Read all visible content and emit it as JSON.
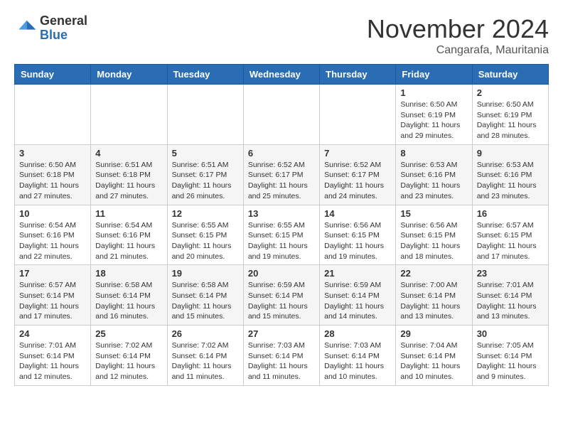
{
  "logo": {
    "general": "General",
    "blue": "Blue"
  },
  "title": "November 2024",
  "location": "Cangarafa, Mauritania",
  "weekdays": [
    "Sunday",
    "Monday",
    "Tuesday",
    "Wednesday",
    "Thursday",
    "Friday",
    "Saturday"
  ],
  "weeks": [
    [
      {
        "day": "",
        "info": ""
      },
      {
        "day": "",
        "info": ""
      },
      {
        "day": "",
        "info": ""
      },
      {
        "day": "",
        "info": ""
      },
      {
        "day": "",
        "info": ""
      },
      {
        "day": "1",
        "info": "Sunrise: 6:50 AM\nSunset: 6:19 PM\nDaylight: 11 hours and 29 minutes."
      },
      {
        "day": "2",
        "info": "Sunrise: 6:50 AM\nSunset: 6:19 PM\nDaylight: 11 hours and 28 minutes."
      }
    ],
    [
      {
        "day": "3",
        "info": "Sunrise: 6:50 AM\nSunset: 6:18 PM\nDaylight: 11 hours and 27 minutes."
      },
      {
        "day": "4",
        "info": "Sunrise: 6:51 AM\nSunset: 6:18 PM\nDaylight: 11 hours and 27 minutes."
      },
      {
        "day": "5",
        "info": "Sunrise: 6:51 AM\nSunset: 6:17 PM\nDaylight: 11 hours and 26 minutes."
      },
      {
        "day": "6",
        "info": "Sunrise: 6:52 AM\nSunset: 6:17 PM\nDaylight: 11 hours and 25 minutes."
      },
      {
        "day": "7",
        "info": "Sunrise: 6:52 AM\nSunset: 6:17 PM\nDaylight: 11 hours and 24 minutes."
      },
      {
        "day": "8",
        "info": "Sunrise: 6:53 AM\nSunset: 6:16 PM\nDaylight: 11 hours and 23 minutes."
      },
      {
        "day": "9",
        "info": "Sunrise: 6:53 AM\nSunset: 6:16 PM\nDaylight: 11 hours and 23 minutes."
      }
    ],
    [
      {
        "day": "10",
        "info": "Sunrise: 6:54 AM\nSunset: 6:16 PM\nDaylight: 11 hours and 22 minutes."
      },
      {
        "day": "11",
        "info": "Sunrise: 6:54 AM\nSunset: 6:16 PM\nDaylight: 11 hours and 21 minutes."
      },
      {
        "day": "12",
        "info": "Sunrise: 6:55 AM\nSunset: 6:15 PM\nDaylight: 11 hours and 20 minutes."
      },
      {
        "day": "13",
        "info": "Sunrise: 6:55 AM\nSunset: 6:15 PM\nDaylight: 11 hours and 19 minutes."
      },
      {
        "day": "14",
        "info": "Sunrise: 6:56 AM\nSunset: 6:15 PM\nDaylight: 11 hours and 19 minutes."
      },
      {
        "day": "15",
        "info": "Sunrise: 6:56 AM\nSunset: 6:15 PM\nDaylight: 11 hours and 18 minutes."
      },
      {
        "day": "16",
        "info": "Sunrise: 6:57 AM\nSunset: 6:15 PM\nDaylight: 11 hours and 17 minutes."
      }
    ],
    [
      {
        "day": "17",
        "info": "Sunrise: 6:57 AM\nSunset: 6:14 PM\nDaylight: 11 hours and 17 minutes."
      },
      {
        "day": "18",
        "info": "Sunrise: 6:58 AM\nSunset: 6:14 PM\nDaylight: 11 hours and 16 minutes."
      },
      {
        "day": "19",
        "info": "Sunrise: 6:58 AM\nSunset: 6:14 PM\nDaylight: 11 hours and 15 minutes."
      },
      {
        "day": "20",
        "info": "Sunrise: 6:59 AM\nSunset: 6:14 PM\nDaylight: 11 hours and 15 minutes."
      },
      {
        "day": "21",
        "info": "Sunrise: 6:59 AM\nSunset: 6:14 PM\nDaylight: 11 hours and 14 minutes."
      },
      {
        "day": "22",
        "info": "Sunrise: 7:00 AM\nSunset: 6:14 PM\nDaylight: 11 hours and 13 minutes."
      },
      {
        "day": "23",
        "info": "Sunrise: 7:01 AM\nSunset: 6:14 PM\nDaylight: 11 hours and 13 minutes."
      }
    ],
    [
      {
        "day": "24",
        "info": "Sunrise: 7:01 AM\nSunset: 6:14 PM\nDaylight: 11 hours and 12 minutes."
      },
      {
        "day": "25",
        "info": "Sunrise: 7:02 AM\nSunset: 6:14 PM\nDaylight: 11 hours and 12 minutes."
      },
      {
        "day": "26",
        "info": "Sunrise: 7:02 AM\nSunset: 6:14 PM\nDaylight: 11 hours and 11 minutes."
      },
      {
        "day": "27",
        "info": "Sunrise: 7:03 AM\nSunset: 6:14 PM\nDaylight: 11 hours and 11 minutes."
      },
      {
        "day": "28",
        "info": "Sunrise: 7:03 AM\nSunset: 6:14 PM\nDaylight: 11 hours and 10 minutes."
      },
      {
        "day": "29",
        "info": "Sunrise: 7:04 AM\nSunset: 6:14 PM\nDaylight: 11 hours and 10 minutes."
      },
      {
        "day": "30",
        "info": "Sunrise: 7:05 AM\nSunset: 6:14 PM\nDaylight: 11 hours and 9 minutes."
      }
    ]
  ]
}
